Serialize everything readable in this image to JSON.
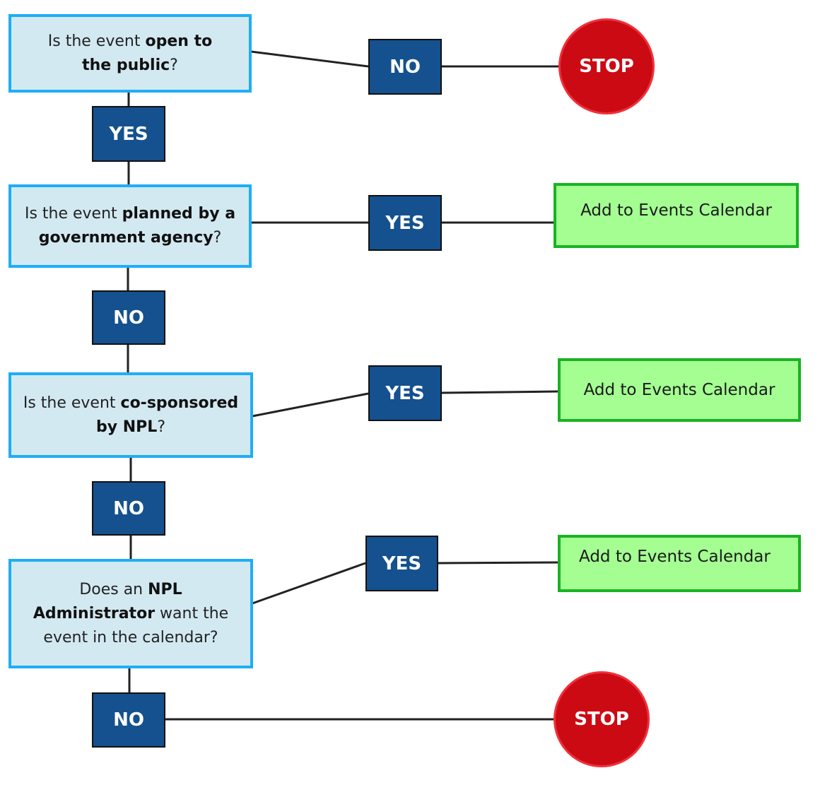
{
  "colors": {
    "question_fill": "#d3e9f2",
    "question_border": "#1eaef6",
    "label_fill": "#14518e",
    "stop_fill": "#cc0a14",
    "action_fill": "#a4fe92",
    "action_border": "#19b322"
  },
  "questions": [
    {
      "parts": [
        "Is the event ",
        "open to the public",
        "?"
      ]
    },
    {
      "parts": [
        "Is the event ",
        "planned by a government agency",
        "?"
      ]
    },
    {
      "parts": [
        "Is the event ",
        "co-sponsored by NPL",
        "?"
      ]
    },
    {
      "parts": [
        "Does an ",
        "NPL Administrator",
        " want the event in the calendar?"
      ]
    }
  ],
  "labels": {
    "yes": "YES",
    "no": "NO"
  },
  "stop": "STOP",
  "action": "Add to Events Calendar"
}
